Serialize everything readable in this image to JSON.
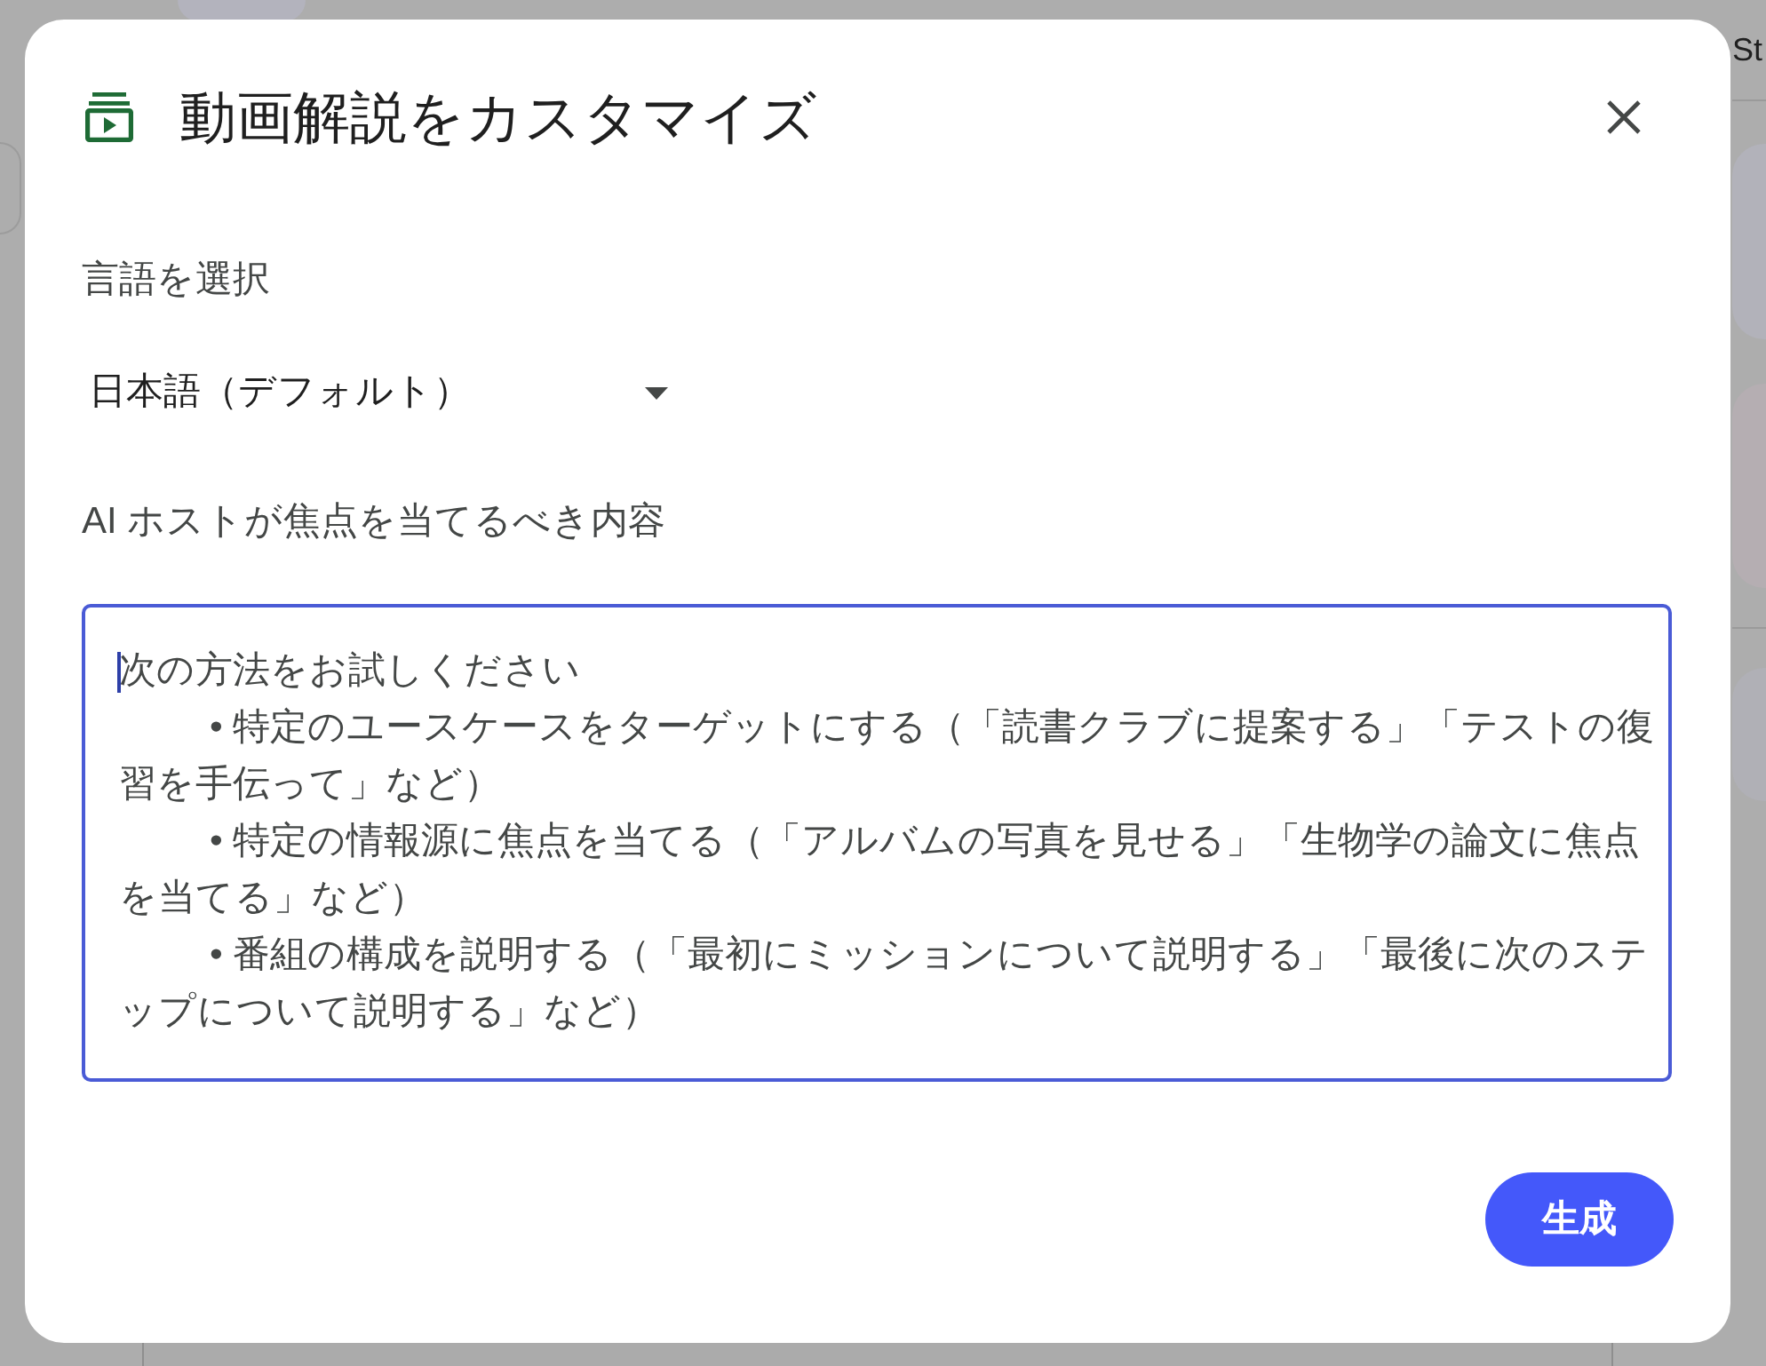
{
  "background": {
    "header_text": "St"
  },
  "dialog": {
    "title": "動画解説をカスタマイズ",
    "language_select": {
      "label": "言語を選択",
      "value": "日本語（デフォルト）"
    },
    "focus_field": {
      "label": "AI ホストが焦点を当てるべき内容",
      "placeholder": "次の方法をお試しください\n\t• 特定のユースケースをターゲットにする（「読書クラブに提案する」「テストの復習を手伝って」など）\n\t• 特定の情報源に焦点を当てる（「アルバムの写真を見せる」「生物学の論文に焦点を当てる」など）\n\t• 番組の構成を説明する（「最初にミッションについて説明する」「最後に次のステップについて説明する」など）",
      "focused": true
    },
    "buttons": [
      {
        "label": "生成",
        "kind": "primary"
      }
    ]
  }
}
